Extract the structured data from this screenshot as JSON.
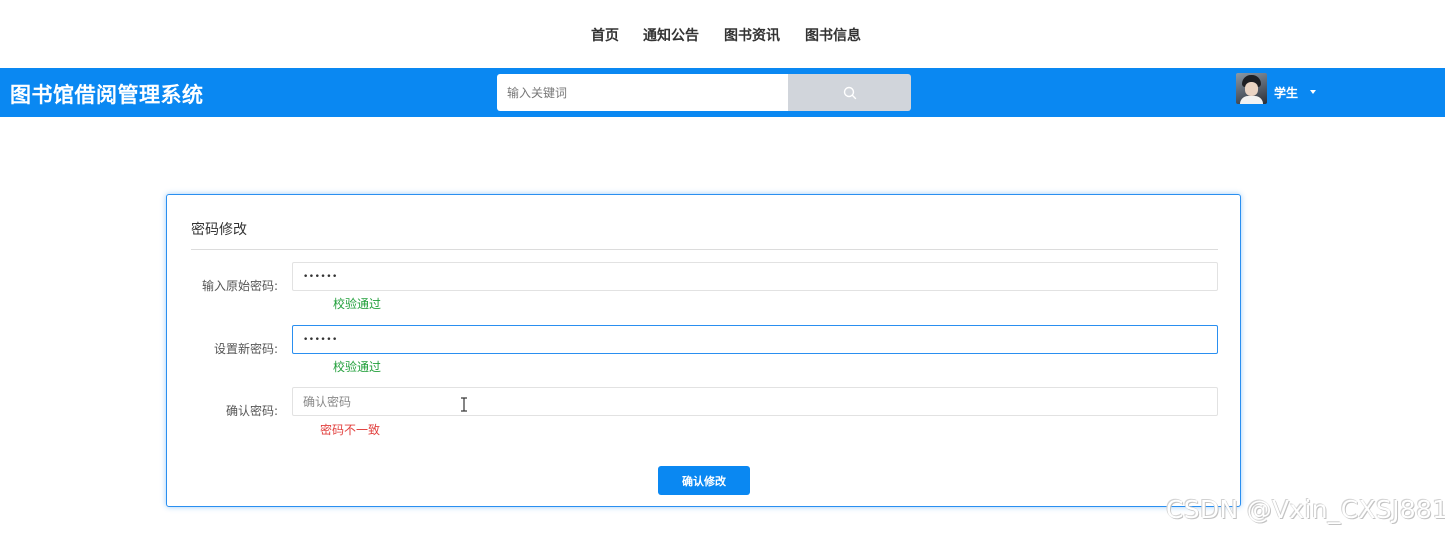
{
  "top_nav": {
    "items": [
      {
        "label": "首页"
      },
      {
        "label": "通知公告"
      },
      {
        "label": "图书资讯"
      },
      {
        "label": "图书信息"
      }
    ]
  },
  "header": {
    "brand": "图书馆借阅管理系统",
    "search": {
      "placeholder": "输入关键词",
      "value": ""
    },
    "search_icon": "search-icon",
    "user": {
      "name": "学生",
      "avatar_icon": "avatar-photo"
    },
    "color": "#0a88f2"
  },
  "card": {
    "title": "密码修改",
    "fields": [
      {
        "label": "输入原始密码:",
        "value": "••••••",
        "type": "password",
        "hint": "校验通过",
        "hint_status": "success"
      },
      {
        "label": "设置新密码:",
        "value": "••••••",
        "type": "password",
        "hint": "校验通过",
        "hint_status": "success",
        "focused": true
      },
      {
        "label": "确认密码:",
        "value": "",
        "placeholder": "确认密码",
        "type": "password",
        "hint": "密码不一致",
        "hint_status": "error"
      }
    ],
    "submit_label": "确认修改"
  },
  "colors": {
    "accent": "#0a88f2",
    "success": "#23a03c",
    "error": "#e2413f"
  },
  "watermark": "CSDN @Vxin_CXSJ881"
}
